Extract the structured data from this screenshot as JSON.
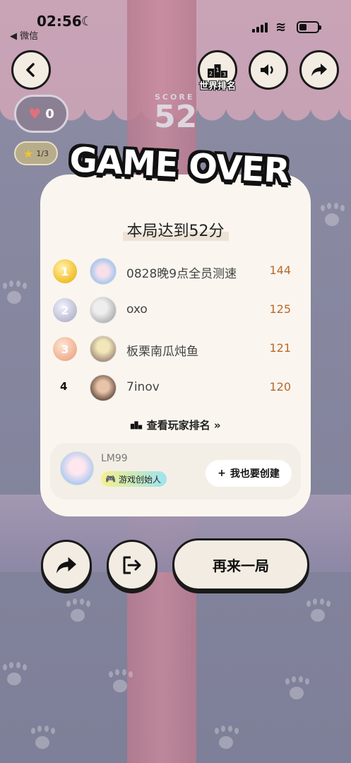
{
  "status_bar": {
    "time": "02:56",
    "back_app": "◀ 微信"
  },
  "top_buttons": {
    "rank_label": "世界排名"
  },
  "score": {
    "label": "SCORE",
    "value": "52"
  },
  "lives": {
    "count": "0"
  },
  "stars": {
    "progress": "1/3"
  },
  "title": "GAME OVER",
  "card": {
    "headline": "本局达到52分",
    "leaderboard": [
      {
        "rank": "1",
        "name": "0828晚9点全员测速",
        "score": "144",
        "medal": "gold"
      },
      {
        "rank": "2",
        "name": "oxo",
        "score": "125",
        "medal": "silver"
      },
      {
        "rank": "3",
        "name": "板栗南瓜炖鱼",
        "score": "121",
        "medal": "bronze"
      },
      {
        "rank": "4",
        "name": "7inov",
        "score": "120",
        "medal": ""
      }
    ],
    "view_rank_label": "查看玩家排名 »",
    "creator": {
      "name": "LM99",
      "tag": "游戏创始人",
      "create_label": "我也要创建"
    }
  },
  "bottom": {
    "again_label": "再来一局"
  },
  "colors": {
    "accent_score": "#b8692a",
    "button_bg": "#f3ece2",
    "outline": "#1a1a1a"
  }
}
